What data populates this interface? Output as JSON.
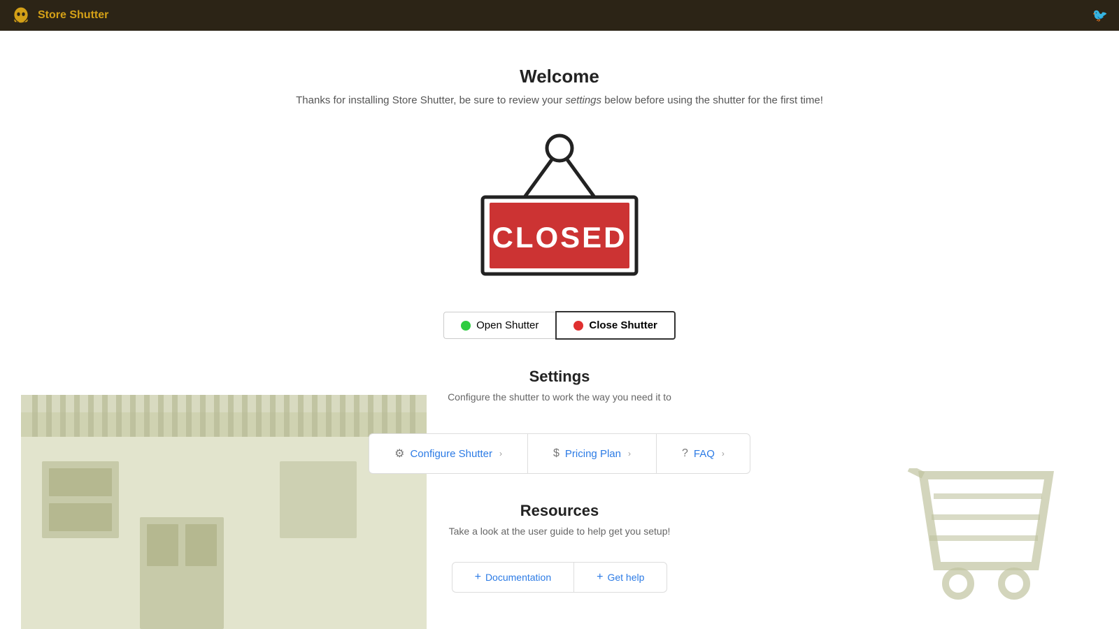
{
  "header": {
    "app_title": "Store Shutter",
    "logo_alt": "store-shutter-logo"
  },
  "welcome": {
    "title": "Welcome",
    "subtitle_prefix": "Thanks for installing Store Shutter, be sure to review your ",
    "subtitle_link": "settings",
    "subtitle_suffix": " below before using the shutter for the first time!"
  },
  "shutter": {
    "open_label": "Open Shutter",
    "close_label": "Close Shutter"
  },
  "settings": {
    "title": "Settings",
    "subtitle": "Configure the shutter to work the way you need it to",
    "cards": [
      {
        "icon": "gear",
        "label": "Configure Shutter"
      },
      {
        "icon": "dollar",
        "label": "Pricing Plan"
      },
      {
        "icon": "question",
        "label": "FAQ"
      }
    ]
  },
  "resources": {
    "title": "Resources",
    "subtitle": "Take a look at the user guide to help get you setup!",
    "links": [
      {
        "label": "Documentation"
      },
      {
        "label": "Get help"
      }
    ]
  }
}
